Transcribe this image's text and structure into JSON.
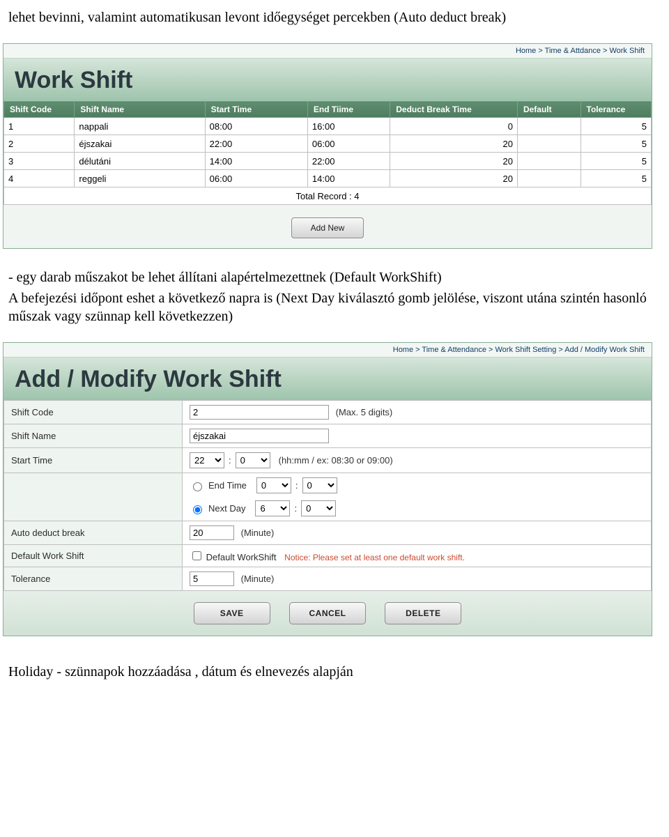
{
  "doc": {
    "p1": "lehet bevinni, valamint automatikusan levont  időegységet percekben (Auto deduct break)",
    "p2_prefix": "-   ",
    "p2": "egy darab műszakot be lehet állítani alapértelmezettnek (Default WorkShift)",
    "p3": "A befejezési időpont eshet a következő napra is  (Next Day kiválasztó gomb jelölése, viszont utána szintén hasonló műszak vagy szünnap kell következzen)",
    "p4": "Holiday -  szünnapok hozzáadása , dátum és elnevezés alapján"
  },
  "list_panel": {
    "breadcrumb": "Home > Time & Attdance > Work Shift",
    "title": "Work Shift",
    "headers": [
      "Shift Code",
      "Shift Name",
      "Start Time",
      "End Tiime",
      "Deduct Break Time",
      "Default",
      "Tolerance"
    ],
    "rows": [
      {
        "code": "1",
        "name": "nappali",
        "start": "08:00",
        "end": "16:00",
        "deduct": "0",
        "default": "",
        "tol": "5"
      },
      {
        "code": "2",
        "name": "éjszakai",
        "start": "22:00",
        "end": "06:00",
        "deduct": "20",
        "default": "",
        "tol": "5"
      },
      {
        "code": "3",
        "name": "délutáni",
        "start": "14:00",
        "end": "22:00",
        "deduct": "20",
        "default": "",
        "tol": "5"
      },
      {
        "code": "4",
        "name": "reggeli",
        "start": "06:00",
        "end": "14:00",
        "deduct": "20",
        "default": "",
        "tol": "5"
      }
    ],
    "total": "Total Record : 4",
    "add_new": "Add New"
  },
  "form_panel": {
    "breadcrumb": "Home > Time & Attendance > Work Shift Setting > Add / Modify Work Shift",
    "title": "Add / Modify Work Shift",
    "labels": {
      "code": "Shift Code",
      "name": "Shift Name",
      "start": "Start Time",
      "end": "End Time",
      "next": "Next Day",
      "deduct": "Auto deduct break",
      "defshift": "Default Work Shift",
      "defshift_cb": "Default WorkShift",
      "tol": "Tolerance"
    },
    "values": {
      "code": "2",
      "name": "éjszakai",
      "start_h": "22",
      "start_m": "0",
      "end_h": "0",
      "end_m": "0",
      "next_h": "6",
      "next_m": "0",
      "deduct": "20",
      "tol": "5"
    },
    "hints": {
      "code": "(Max. 5 digits)",
      "start": "(hh:mm / ex: 08:30 or 09:00)",
      "minute": "(Minute)",
      "colon": ":"
    },
    "notice": "Notice: Please set at least one default work shift.",
    "buttons": {
      "save": "SAVE",
      "cancel": "CANCEL",
      "delete": "DELETE"
    }
  }
}
